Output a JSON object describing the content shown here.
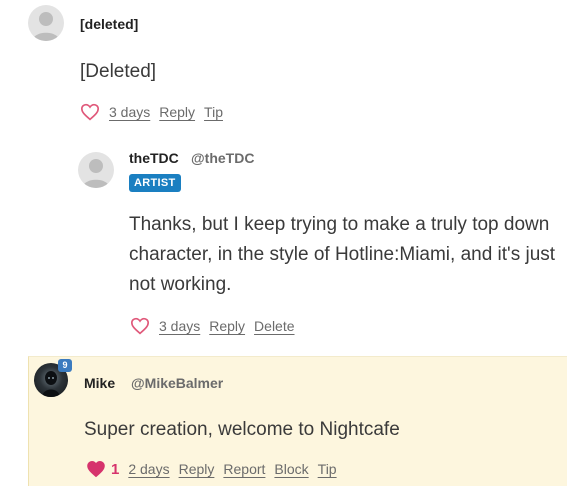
{
  "comments": [
    {
      "username": "[deleted]",
      "body": "[Deleted]",
      "actions": {
        "time": "3 days",
        "reply": "Reply",
        "tip": "Tip"
      }
    },
    {
      "username": "theTDC",
      "handle": "@theTDC",
      "badge": "ARTIST",
      "body": "Thanks, but I keep trying to make a truly top down character, in the style of Hotline:Miami, and it's just not working.",
      "actions": {
        "time": "3 days",
        "reply": "Reply",
        "delete": "Delete"
      }
    },
    {
      "username": "Mike",
      "handle": "@MikeBalmer",
      "level": "9",
      "body": "Super creation, welcome to Nightcafe",
      "likes": "1",
      "liked": true,
      "actions": {
        "time": "2 days",
        "reply": "Reply",
        "report": "Report",
        "block": "Block",
        "tip": "Tip"
      }
    }
  ],
  "colors": {
    "heart_outline": "#e0587a",
    "heart_filled": "#d6336c",
    "artist_badge": "#1a7fc1",
    "highlight_bg": "#fdf6de"
  }
}
